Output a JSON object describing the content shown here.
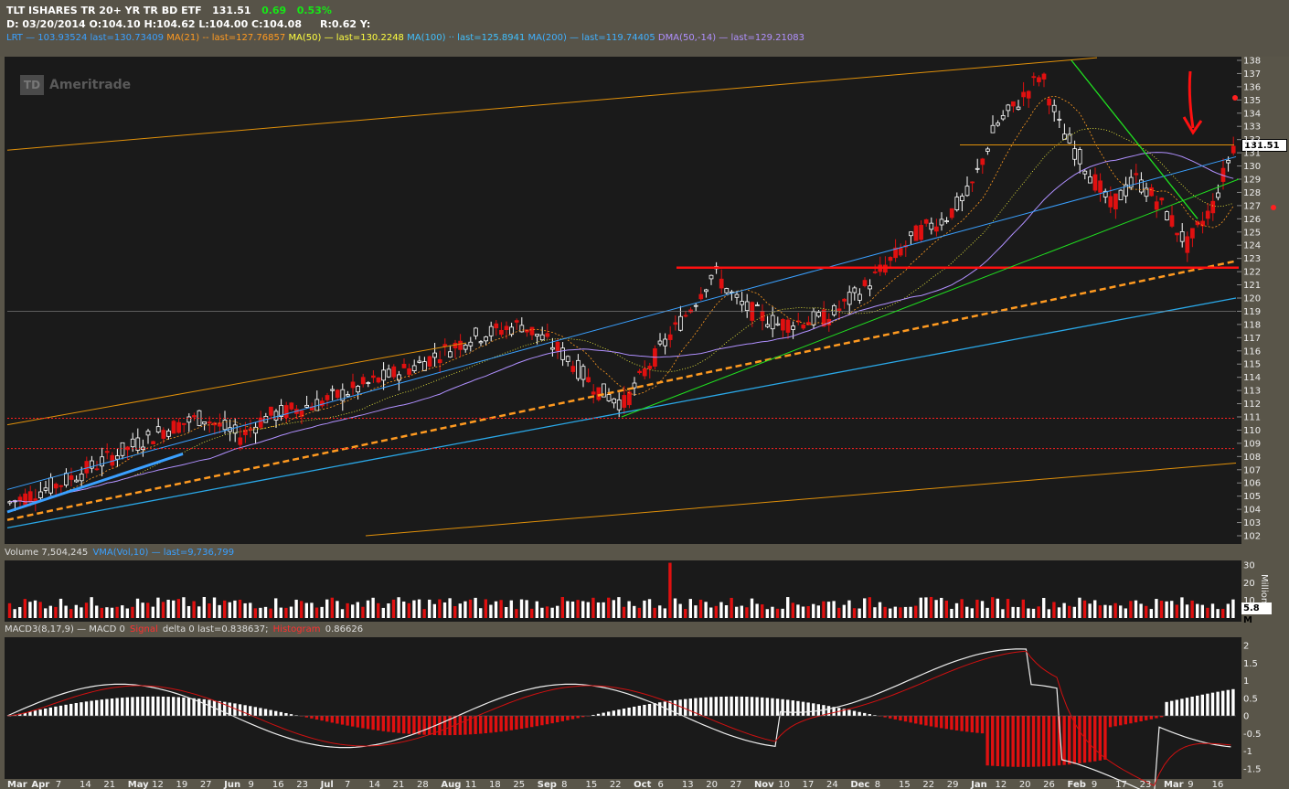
{
  "header": {
    "title": "TLT ISHARES TR 20+ YR TR BD ETF",
    "last": "131.51",
    "change": "0.69",
    "change_pct": "0.53%",
    "ohlc": "D: 03/20/2014 O:104.10 H:104.62 L:104.00 C:104.08",
    "r_label": "R:0.62   Y:",
    "studies_line": [
      {
        "text": "LRT — 103.93524 last=130.73409",
        "color": "#3aa0ff"
      },
      {
        "text": "MA(21)  -- last=127.76857",
        "color": "#ff9a20"
      },
      {
        "text": "MA(50)  — last=130.2248",
        "color": "#ffff40"
      },
      {
        "text": "MA(100) ·· last=125.8941",
        "color": "#40c0ff"
      },
      {
        "text": "MA(200) — last=119.74405",
        "color": "#40b0ff"
      },
      {
        "text": "DMA(50,-14) — last=129.21083",
        "color": "#b090ff"
      }
    ]
  },
  "watermark": "Ameritrade",
  "watermark_logo": "TD",
  "volume_strip": {
    "label": "Volume 7,504,245",
    "study": "VMA(Vol,10) — last=9,736,799",
    "unit": "Million",
    "current": "5.8 M"
  },
  "macd_strip": {
    "label": "MACD3(8,17,9)  — MACD 0",
    "delta": "delta 0 last=0.838637;",
    "value": "0.86626"
  },
  "colors": {
    "up": "#ffffff",
    "down": "#e01010",
    "grid": "#2a2a2a",
    "channel": "#e0900a",
    "support": "#ff1010",
    "ma50": "#ffff40",
    "ma200": "#2aa8e8"
  },
  "chart_data": {
    "type": "candlestick",
    "y_axis": {
      "min": 102,
      "max": 138,
      "ticks": [
        102,
        103,
        104,
        105,
        106,
        107,
        108,
        109,
        110,
        111,
        112,
        113,
        114,
        115,
        116,
        117,
        118,
        119,
        120,
        121,
        122,
        123,
        124,
        125,
        126,
        127,
        128,
        129,
        130,
        131,
        132,
        133,
        134,
        135,
        136,
        137,
        138
      ]
    },
    "x_axis_labels": [
      "Mar",
      "Apr",
      "7",
      "14",
      "21",
      "May",
      "12",
      "19",
      "27",
      "Jun",
      "9",
      "16",
      "23",
      "Jul",
      "7",
      "14",
      "21",
      "28",
      "Aug",
      "11",
      "18",
      "25",
      "Sep",
      "8",
      "15",
      "22",
      "Oct",
      "6",
      "13",
      "20",
      "27",
      "Nov",
      "10",
      "17",
      "24",
      "Dec",
      "8",
      "15",
      "22",
      "29",
      "Jan",
      "12",
      "20",
      "26",
      "Feb",
      "9",
      "17",
      "23",
      "Mar",
      "9",
      "16"
    ],
    "last_price": 131.51,
    "support_level": 122.3,
    "resistance_level": 131.6,
    "horizontal_dotted_levels": [
      110.9,
      108.6
    ],
    "volume_axis": {
      "max": 30,
      "ticks": [
        10,
        20,
        30
      ],
      "unit": "Million"
    },
    "macd_axis": {
      "min": -1.5,
      "max": 2,
      "ticks": [
        2,
        1.5,
        1,
        0.5,
        0,
        -0.5,
        -1,
        -1.5
      ]
    }
  }
}
